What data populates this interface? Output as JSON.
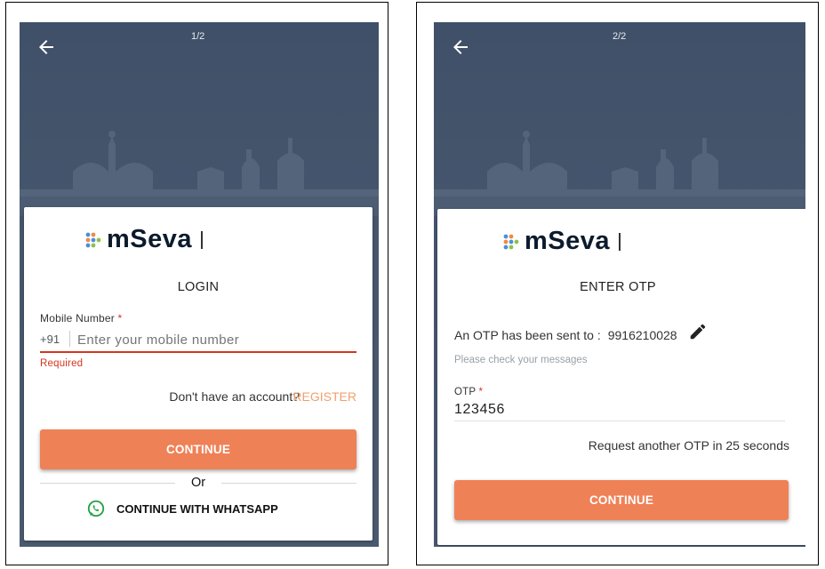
{
  "login": {
    "step": "1/2",
    "brand": "mSeva",
    "heading": "LOGIN",
    "mobile_label": "Mobile Number",
    "required_mark": "*",
    "country_code": "+91",
    "mobile_placeholder": "Enter your mobile number",
    "error_text": "Required",
    "no_account_text": "Don't have an account?",
    "register_link": "REGISTER",
    "continue_label": "CONTINUE",
    "or_text": "Or",
    "whatsapp_label": "CONTINUE WITH WHATSAPP"
  },
  "otp": {
    "step": "2/2",
    "brand": "mSeva",
    "heading": "ENTER OTP",
    "sent_text": "An OTP has been sent to :",
    "phone_number": "9916210028",
    "check_messages": "Please check your messages",
    "otp_label": "OTP",
    "required_mark": "*",
    "otp_value": "123456",
    "resend_text": "Request another OTP in 25 seconds",
    "continue_label": "CONTINUE"
  },
  "colors": {
    "accent": "#ef8157",
    "error": "#d4351c",
    "header_bg": "#3f5068",
    "whatsapp": "#25a244"
  },
  "icons": [
    "back-arrow-icon",
    "mseva-logo-icon",
    "whatsapp-icon",
    "edit-pencil-icon"
  ]
}
